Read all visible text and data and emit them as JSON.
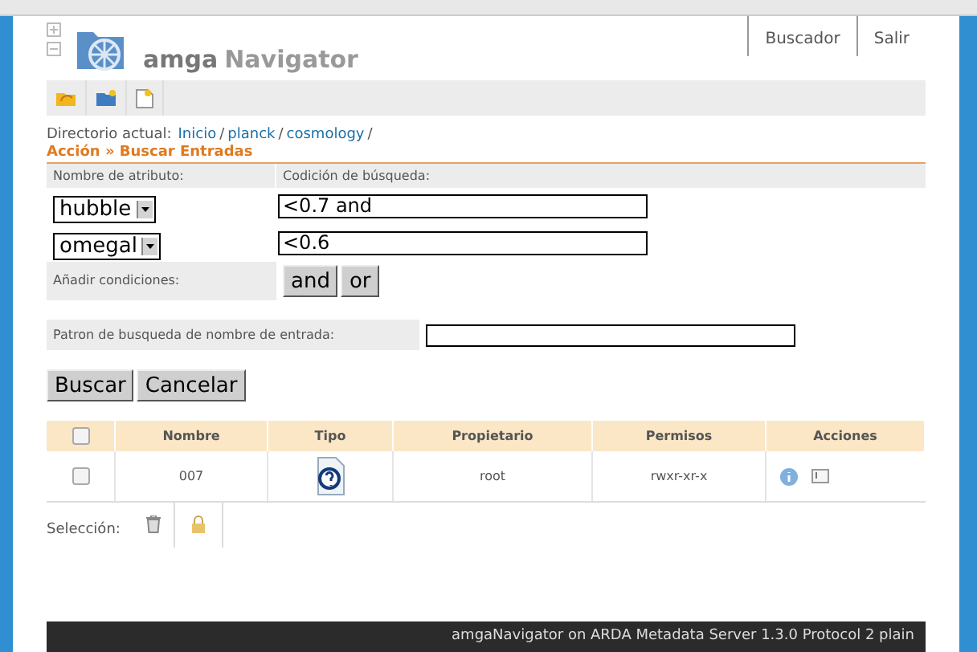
{
  "header": {
    "logo_text": "amga",
    "logo_text2": "Navigator",
    "nav": [
      "Buscador",
      "Salir"
    ]
  },
  "breadcrumb": {
    "label": "Directorio actual:",
    "links": [
      "Inicio",
      "planck",
      "cosmology"
    ],
    "separator": "/"
  },
  "action_title": "Acción » Buscar Entradas",
  "conditions": {
    "columns": [
      "Nombre de atributo:",
      "Codición de búsqueda:"
    ],
    "rows": [
      {
        "attribute": "hubble",
        "value": "<0.7 and"
      },
      {
        "attribute": "omegal",
        "value": "<0.6"
      }
    ],
    "add_label": "Añadir condiciones:",
    "add_buttons": [
      "and",
      "or"
    ]
  },
  "pattern": {
    "label": "Patron de busqueda de nombre de entrada:"
  },
  "buttons": [
    "Buscar",
    "Cancelar"
  ],
  "table": {
    "columns": [
      "Nombre",
      "Tipo",
      "Propietario",
      "Permisos",
      "Acciones"
    ],
    "all_checked": false,
    "rows": [
      {
        "checked": false,
        "name": "007",
        "owner": "root",
        "permissions": "rwxr-xr-x"
      }
    ]
  },
  "selection_label": "Selección:",
  "footer": "amgaNavigator on ARDA Metadata Server 1.3.0 Protocol 2 plain"
}
